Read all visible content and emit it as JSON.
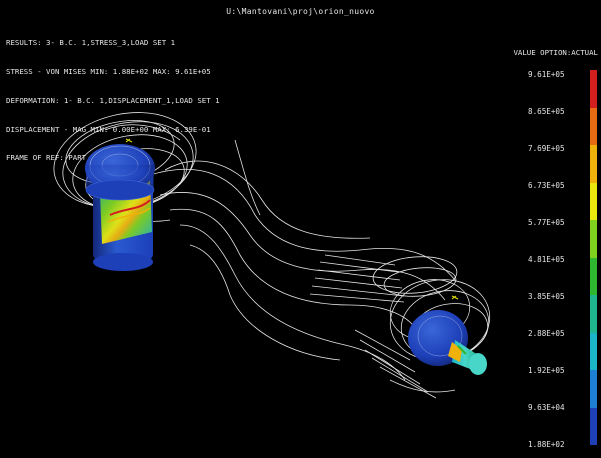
{
  "window": {
    "path": "U:\\Mantovani\\proj\\orion_nuovo"
  },
  "results_info": [
    "RESULTS: 3- B.C. 1,STRESS_3,LOAD SET 1",
    "STRESS - VON MISES MIN: 1.88E+02 MAX: 9.61E+05",
    "DEFORMATION: 1- B.C. 1,DISPLACEMENT_1,LOAD SET 1",
    "DISPLACEMENT - MAG MIN: 0.00E+00 MAX: 6.39E-01",
    "FRAME OF REF: PART"
  ],
  "value_option": "VALUE OPTION:ACTUAL",
  "legend": {
    "labels": [
      "9.61E+05",
      "8.65E+05",
      "7.69E+05",
      "6.73E+05",
      "5.77E+05",
      "4.81E+05",
      "3.85E+05",
      "2.88E+05",
      "1.92E+05",
      "9.63E+04",
      "1.88E+02"
    ],
    "colors": [
      "#d41f1f",
      "#e86a12",
      "#f0b20a",
      "#e8e80f",
      "#7fd11d",
      "#2fb82f",
      "#20b58d",
      "#1cb5c8",
      "#1e7fd6",
      "#1d3fb8"
    ]
  }
}
